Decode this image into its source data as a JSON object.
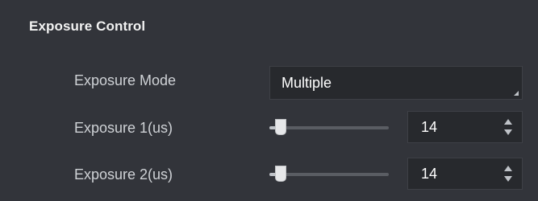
{
  "section": {
    "title": "Exposure Control"
  },
  "rows": [
    {
      "label": "Exposure Mode",
      "type": "select",
      "value": "Multiple"
    },
    {
      "label": "Exposure 1(us)",
      "type": "slider-spin",
      "value": "14",
      "slider_fraction": 0.05
    },
    {
      "label": "Exposure 2(us)",
      "type": "slider-spin",
      "value": "14",
      "slider_fraction": 0.05
    }
  ],
  "colors": {
    "panel_bg": "#32343a",
    "field_bg": "#27292d",
    "text": "#cfd2d6",
    "value_text": "#ffffff"
  },
  "icons": {
    "select_corner": "resize-corner-icon",
    "spin_up": "spin-up-icon",
    "spin_down": "spin-down-icon"
  }
}
